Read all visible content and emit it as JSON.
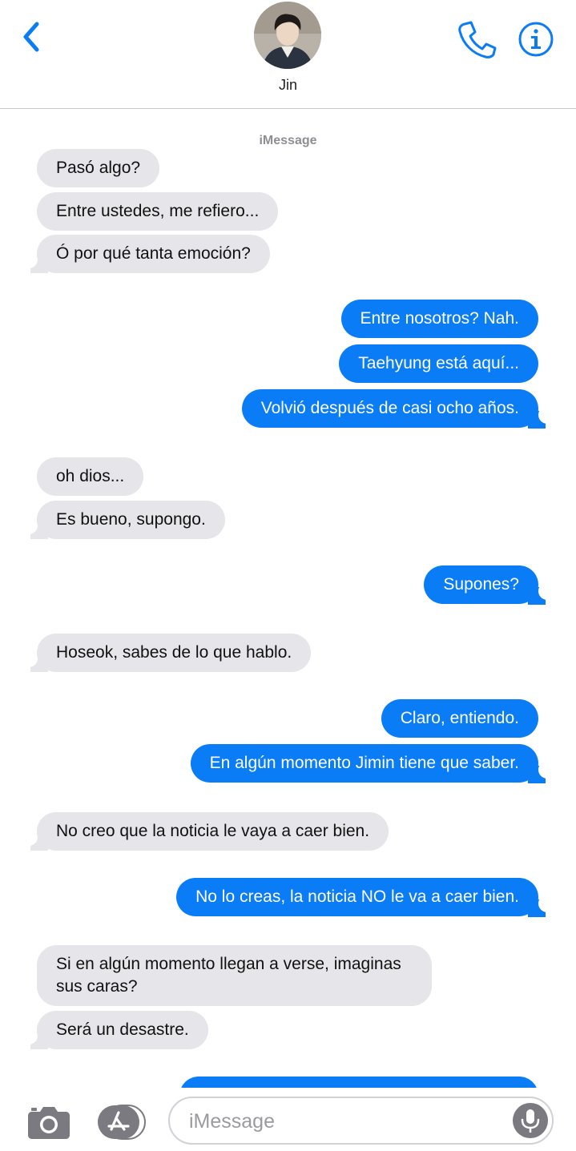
{
  "header": {
    "contact_name": "Jin",
    "accent_color": "#0a7cf6"
  },
  "thread": {
    "service_label": "iMessage",
    "messages": [
      {
        "dir": "in",
        "text": "Pasó algo?"
      },
      {
        "dir": "in",
        "text": "Entre ustedes, me refiero..."
      },
      {
        "dir": "in",
        "text": "Ó por qué tanta emoción?"
      },
      {
        "dir": "out",
        "text": "Entre nosotros? Nah."
      },
      {
        "dir": "out",
        "text": "Taehyung está aquí..."
      },
      {
        "dir": "out",
        "text": "Volvió después de casi ocho años."
      },
      {
        "dir": "in",
        "text": "oh dios..."
      },
      {
        "dir": "in",
        "text": "Es bueno, supongo."
      },
      {
        "dir": "out",
        "text": "Supones?"
      },
      {
        "dir": "in",
        "text": "Hoseok, sabes de lo que hablo."
      },
      {
        "dir": "out",
        "text": "Claro, entiendo."
      },
      {
        "dir": "out",
        "text": "En algún momento Jimin tiene que saber."
      },
      {
        "dir": "in",
        "text": "No creo que la noticia le vaya a caer bien."
      },
      {
        "dir": "out",
        "text": "No lo creas, la noticia NO le va a caer bien."
      },
      {
        "dir": "in",
        "text": "Si en algún momento llegan a verse, imaginas sus caras?"
      },
      {
        "dir": "in",
        "text": "Será un desastre."
      }
    ]
  },
  "input": {
    "placeholder": "iMessage"
  },
  "icons": {
    "back": "chevron-left-icon",
    "call": "phone-icon",
    "info": "info-icon",
    "camera": "camera-icon",
    "apps": "app-store-icon",
    "mic": "microphone-icon"
  },
  "colors": {
    "incoming_bubble": "#e5e5ea",
    "outgoing_bubble": "#0a7cf6"
  }
}
